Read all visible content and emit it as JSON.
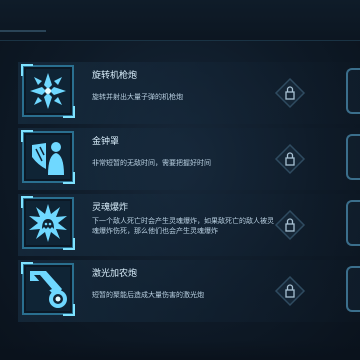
{
  "skills": [
    {
      "name": "旋转机枪炮",
      "description": "旋转并射出大量子弹的机枪炮",
      "icon": "spinning-machine-gun-icon",
      "locked": true
    },
    {
      "name": "金钟罩",
      "description": "非常短暂的无敌时间，需要把握好时间",
      "icon": "golden-shield-icon",
      "locked": true
    },
    {
      "name": "灵魂爆炸",
      "description": "下一个敌人死亡时会产生灵魂爆炸，如果敌死亡的敌人被灵魂爆炸伤死，那么他们也会产生灵魂爆炸",
      "icon": "soul-explosion-icon",
      "locked": true
    },
    {
      "name": "激光加农炮",
      "description": "短暂的聚能后造成大量伤害的激光炮",
      "icon": "laser-cannon-icon",
      "locked": true
    }
  ],
  "colors": {
    "accent": "#7fe3ff",
    "frame": "#2a6f8f",
    "text": "#d9eefb"
  }
}
